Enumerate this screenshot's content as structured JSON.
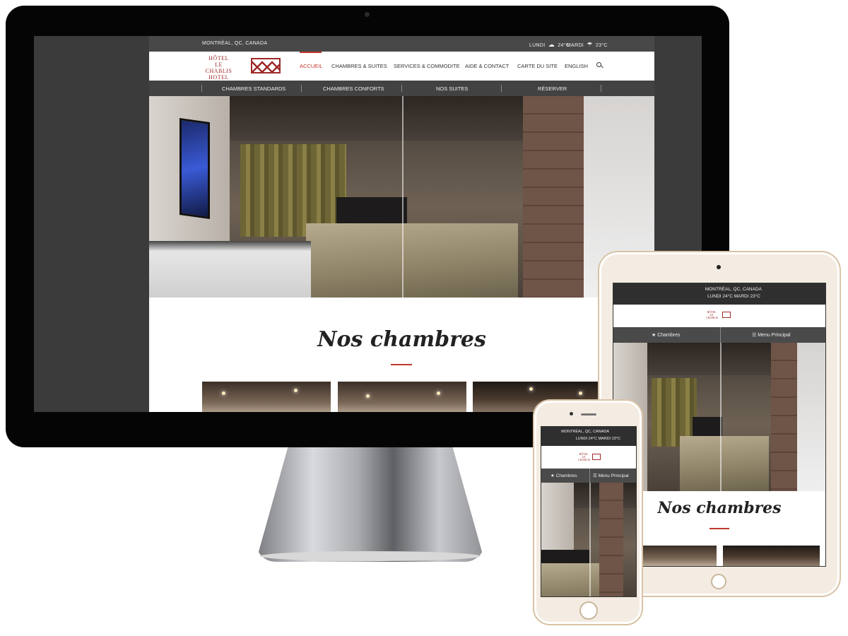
{
  "desktop": {
    "topbar": {
      "location": "MONTRÉAL, QC, CANADA",
      "weather": [
        {
          "day": "LUNDI",
          "temp": "24°C",
          "icon": "partly-cloudy-icon"
        },
        {
          "day": "MARDI",
          "temp": "23°C",
          "icon": "cloud-rain-icon"
        }
      ]
    },
    "logo": {
      "line1": "HÔTEL",
      "line2": "LE CHABLIS",
      "line3": "HOTEL"
    },
    "nav": [
      "ACCUEIL",
      "CHAMBRES & SUITES",
      "SERVICES & COMMODITE",
      "AIDE & CONTACT",
      "CARTE DU SITE",
      "ENGLISH"
    ],
    "active_nav": "ACCUEIL",
    "subnav": [
      "CHAMBRES STANDARDS",
      "CHAMBRES CONFORTS",
      "NOS SUITES",
      "RÉSERVER"
    ],
    "section_heading": "Nos chambres"
  },
  "mobile": {
    "location": "MONTRÉAL, QC, CANADA",
    "weather_line": "LUNDI 24°C  MARDI 23°C",
    "menu_left": "★ Chambres",
    "menu_right": "☰ Menu Principal",
    "section_heading": "Nos chambres"
  },
  "colors": {
    "accent": "#c0392b",
    "brand": "#9e2a2a",
    "topbar": "#2f2f2f",
    "background_pattern": "#3b3b3b"
  }
}
